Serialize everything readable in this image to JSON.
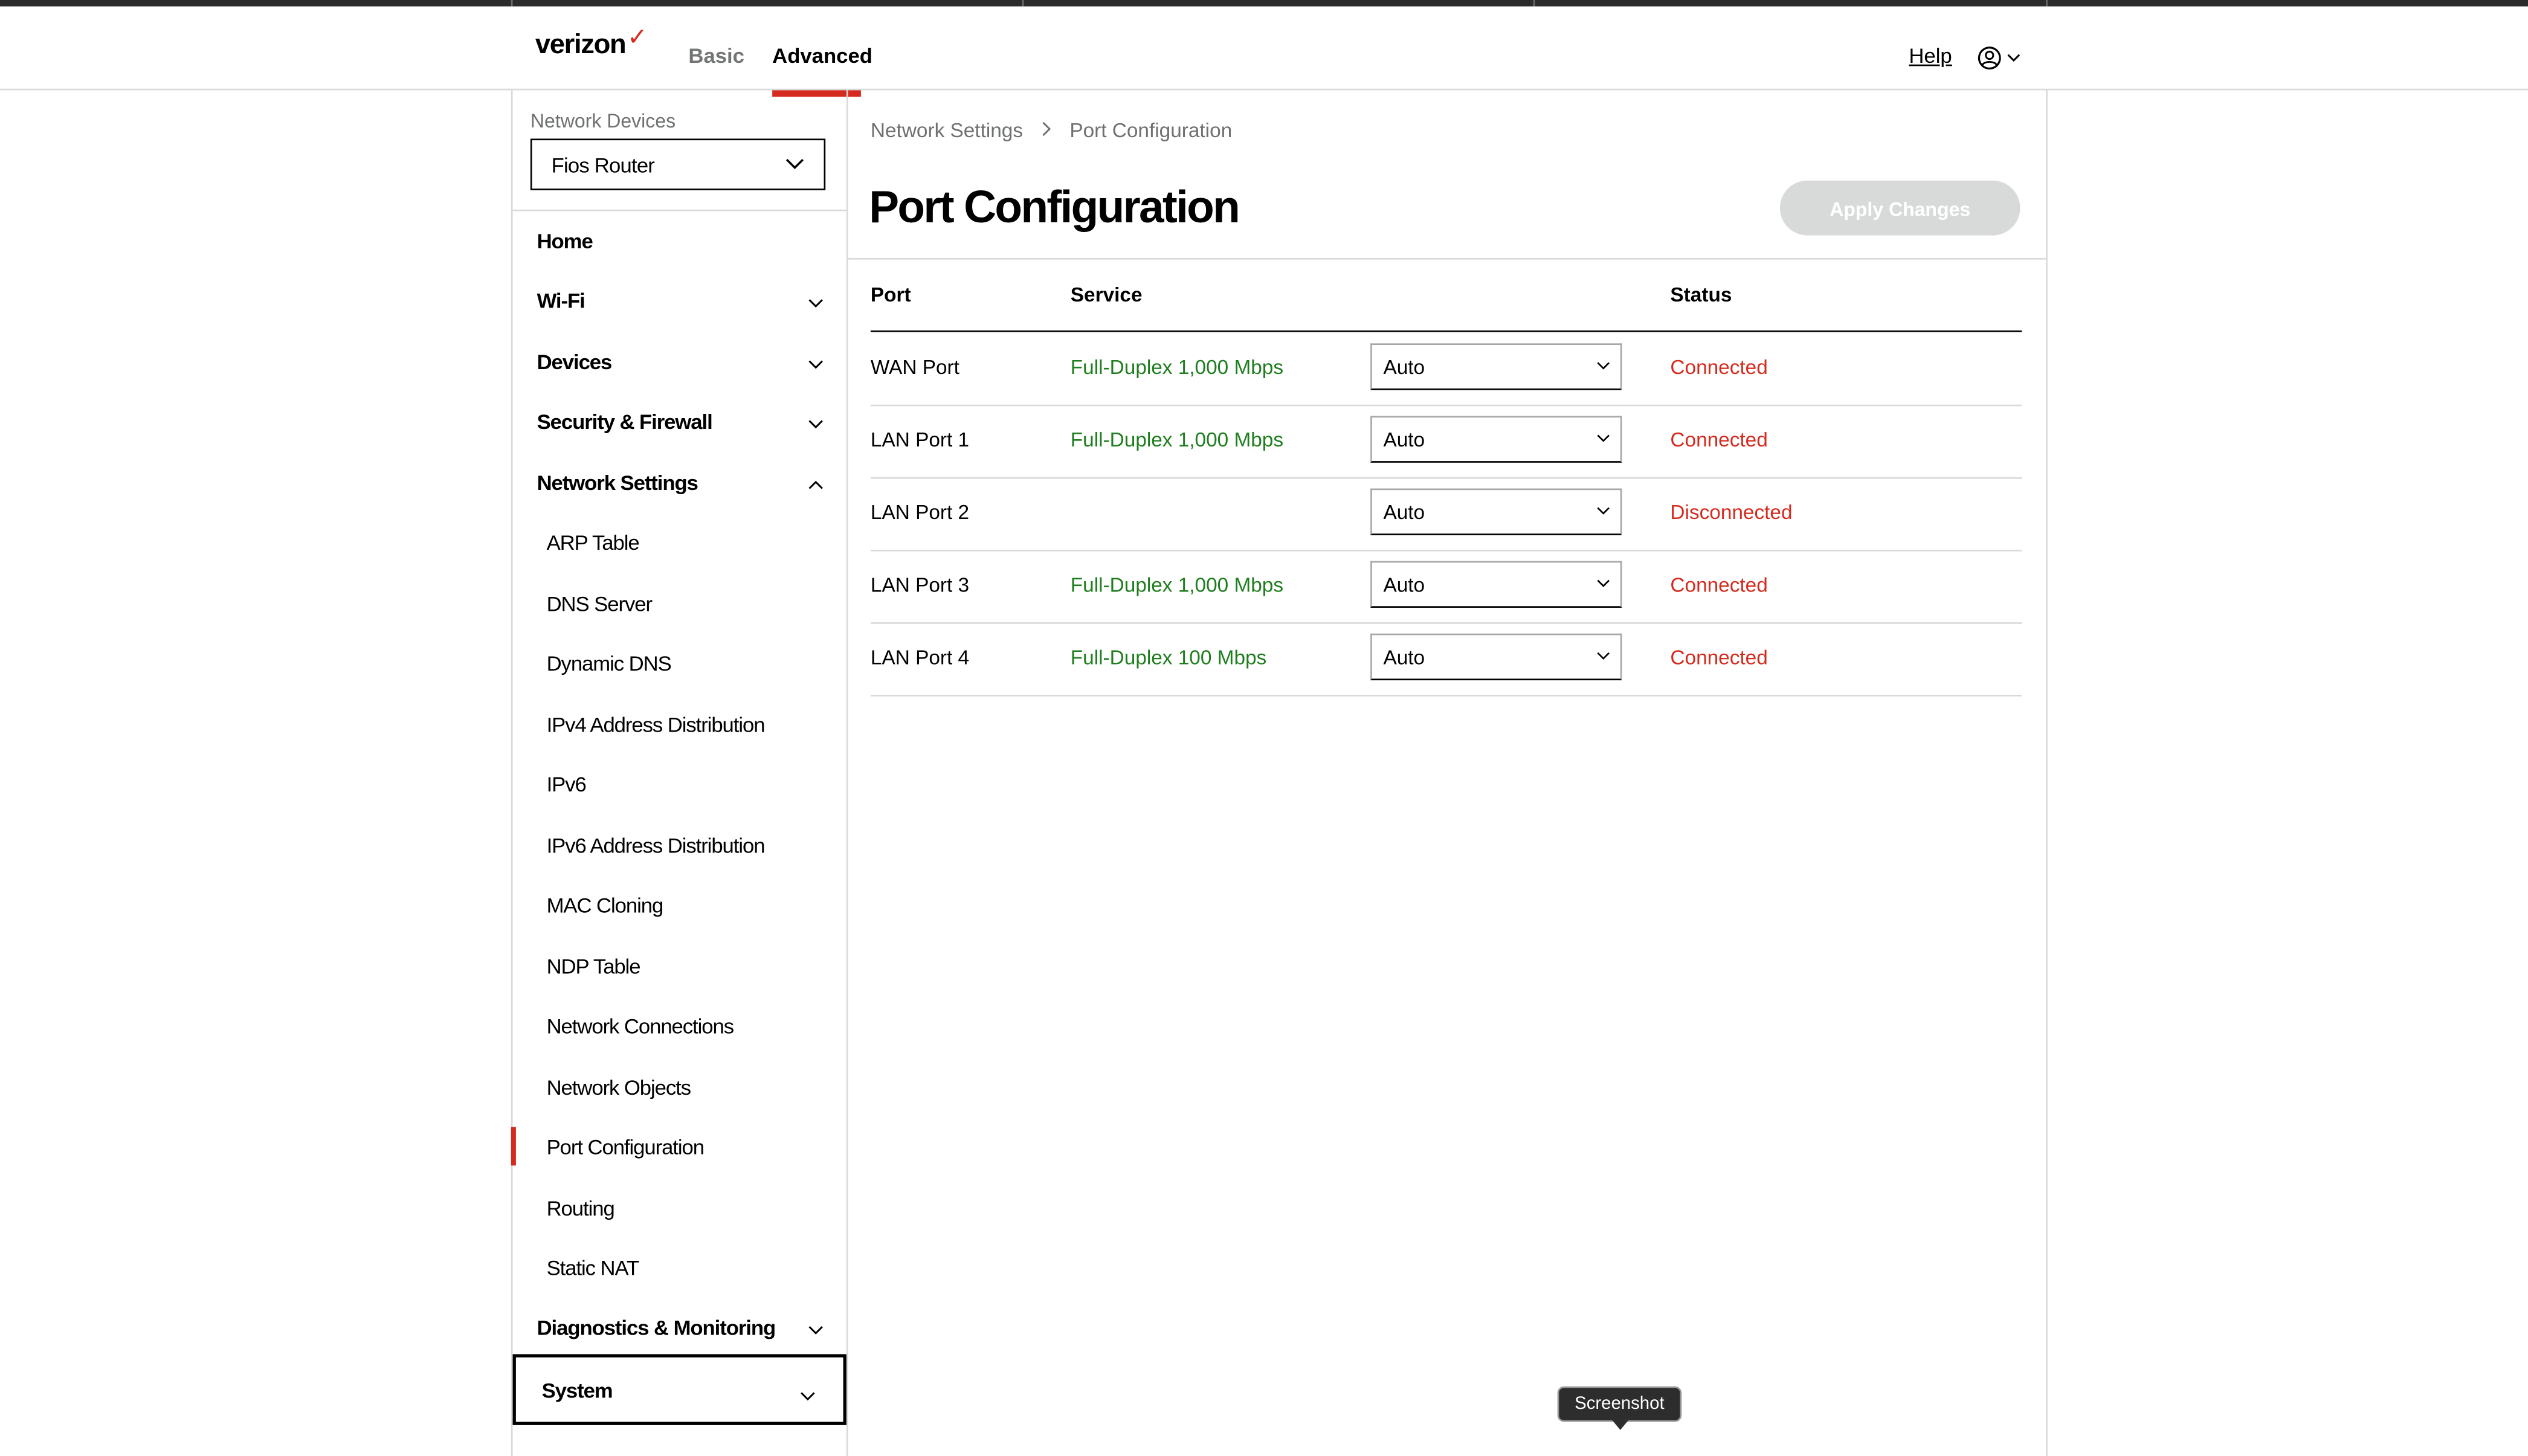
{
  "header": {
    "brand": "verizon",
    "brand_mark": "✓",
    "tabs": [
      {
        "label": "Basic",
        "active": false
      },
      {
        "label": "Advanced",
        "active": true
      }
    ],
    "help_label": "Help",
    "user_icon": "user-circle-icon",
    "accent_color": "#d52b1e"
  },
  "sidebar": {
    "device_label": "Network Devices",
    "device_selected": "Fios Router",
    "items": [
      {
        "label": "Home"
      },
      {
        "label": "Wi-Fi",
        "icon": "chevron-down-icon"
      },
      {
        "label": "Devices",
        "icon": "chevron-down-icon"
      },
      {
        "label": "Security & Firewall",
        "icon": "chevron-down-icon"
      },
      {
        "label": "Network Settings",
        "icon": "chevron-up-icon"
      }
    ],
    "subitems": [
      {
        "label": "ARP Table"
      },
      {
        "label": "DNS Server"
      },
      {
        "label": "Dynamic DNS"
      },
      {
        "label": "IPv4 Address Distribution"
      },
      {
        "label": "IPv6"
      },
      {
        "label": "IPv6 Address Distribution"
      },
      {
        "label": "MAC Cloning"
      },
      {
        "label": "NDP Table"
      },
      {
        "label": "Network Connections"
      },
      {
        "label": "Network Objects"
      },
      {
        "label": "Port Configuration",
        "active": true
      },
      {
        "label": "Routing"
      },
      {
        "label": "Static NAT"
      }
    ],
    "diagnostics": {
      "label": "Diagnostics & Monitoring",
      "icon": "chevron-down-icon"
    },
    "system": {
      "label": "System",
      "icon": "chevron-down-icon"
    }
  },
  "main": {
    "breadcrumb": [
      "Network Settings",
      "Port Configuration"
    ],
    "title": "Port Configuration",
    "apply_label": "Apply Changes",
    "columns": {
      "port": "Port",
      "service": "Service",
      "status": "Status"
    },
    "rows": [
      {
        "port": "WAN Port",
        "service": "Full-Duplex 1,000 Mbps",
        "mode": "Auto",
        "status": "Connected"
      },
      {
        "port": "LAN Port 1",
        "service": "Full-Duplex 1,000 Mbps",
        "mode": "Auto",
        "status": "Connected"
      },
      {
        "port": "LAN Port 2",
        "service": "",
        "mode": "Auto",
        "status": "Disconnected"
      },
      {
        "port": "LAN Port 3",
        "service": "Full-Duplex 1,000 Mbps",
        "mode": "Auto",
        "status": "Connected"
      },
      {
        "port": "LAN Port 4",
        "service": "Full-Duplex 100 Mbps",
        "mode": "Auto",
        "status": "Connected"
      }
    ]
  },
  "tooltip": "Screenshot"
}
